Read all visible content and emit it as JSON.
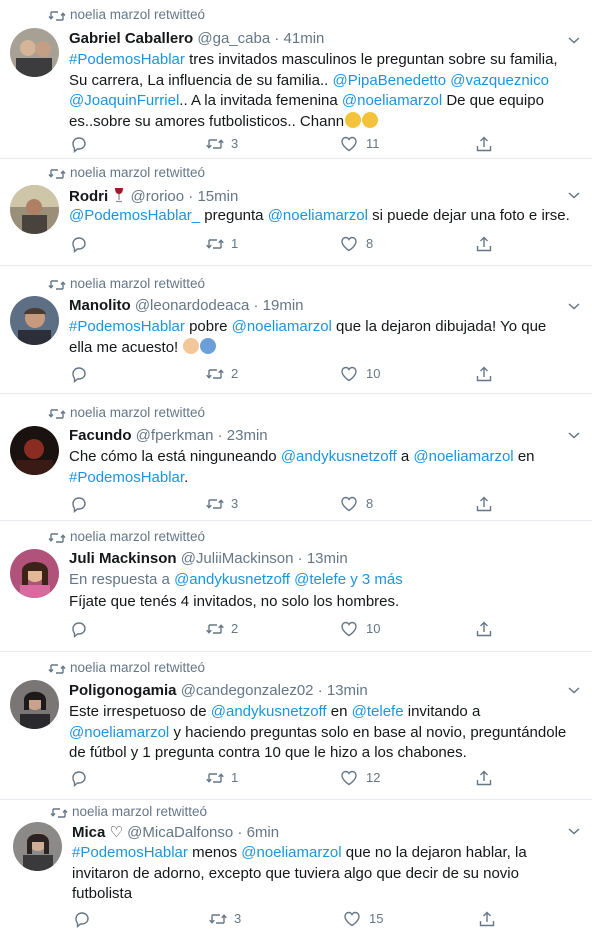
{
  "retweet_label": "noelia marzol retwitteó",
  "icons": {
    "retweet": "retweet-icon",
    "reply": "reply-icon",
    "like": "heart-icon",
    "share": "share-icon",
    "caret": "chevron-down-icon"
  },
  "colors": {
    "link": "#1b95e0",
    "muted": "#657786",
    "divider": "#e6ecf0",
    "text": "#14171a"
  },
  "tweets": [
    {
      "name": "Gabriel Caballero",
      "handle": "@ga_caba",
      "sep": "·",
      "time": "41min",
      "lines": [
        [
          "#PodemosHablar",
          " tres invitados masculinos le preguntan sobre su familia,"
        ],
        [
          "Su carrera, La influencia de su familia.. ",
          "@PipaBenedetto",
          " ",
          "@vazqueznico"
        ],
        [
          "@JoaquinFurriel",
          ".. A la invitada femenina ",
          "@noeliamarzol",
          " De que equipo"
        ],
        [
          "es..sobre su amores futbolisticos.. Chann"
        ]
      ],
      "retweets": "3",
      "likes": "11"
    },
    {
      "name": "Rodri",
      "handle": "@rorioo",
      "sep": "·",
      "time": "15min",
      "lines": [
        [
          "@PodemosHablar_",
          " pregunta ",
          "@noeliamarzol",
          " si puede dejar una foto e irse."
        ]
      ],
      "retweets": "1",
      "likes": "8"
    },
    {
      "name": "Manolito",
      "handle": "@leonardodeaca",
      "sep": "·",
      "time": "19min",
      "lines": [
        [
          "#PodemosHablar",
          " pobre ",
          "@noeliamarzol",
          " que la dejaron dibujada! Yo que"
        ],
        [
          "ella me acuesto! "
        ]
      ],
      "retweets": "2",
      "likes": "10"
    },
    {
      "name": "Facundo",
      "handle": "@fperkman",
      "sep": "·",
      "time": "23min",
      "lines": [
        [
          "Che cómo la está ninguneando ",
          "@andykusnetzoff",
          " a ",
          "@noeliamarzol",
          " en"
        ],
        [
          "#PodemosHablar",
          "."
        ]
      ],
      "retweets": "3",
      "likes": "8"
    },
    {
      "name": "Juli Mackinson",
      "handle": "@JuliiMackinson",
      "sep": "·",
      "time": "13min",
      "reply_to": [
        "En respuesta a ",
        "@andykusnetzoff",
        " ",
        "@telefe y 3 más"
      ],
      "lines": [
        [
          "Fíjate que tenés 4 invitados, no solo los hombres."
        ]
      ],
      "retweets": "2",
      "likes": "10"
    },
    {
      "name": "Poligonogamia",
      "handle": "@candegonzalez02",
      "sep": "·",
      "time": "13min",
      "lines": [
        [
          "Este irrespetuoso de ",
          "@andykusnetzoff",
          "  en ",
          "@telefe",
          " invitando a"
        ],
        [
          "@noeliamarzol",
          " y haciendo preguntas solo en base al novio, preguntándole"
        ],
        [
          "de fútbol y 1 pregunta contra 10 que le hizo a los chabones."
        ]
      ],
      "retweets": "1",
      "likes": "12"
    },
    {
      "name": "Mica ♡",
      "handle": "@MicaDalfonso",
      "sep": "·",
      "time": "6min",
      "lines": [
        [
          "#PodemosHablar",
          " menos ",
          "@noeliamarzol",
          " que no la dejaron hablar, la"
        ],
        [
          "invitaron de adorno, excepto que tuviera algo que decir de su novio"
        ],
        [
          "futbolista"
        ]
      ],
      "retweets": "3",
      "likes": "15"
    }
  ]
}
